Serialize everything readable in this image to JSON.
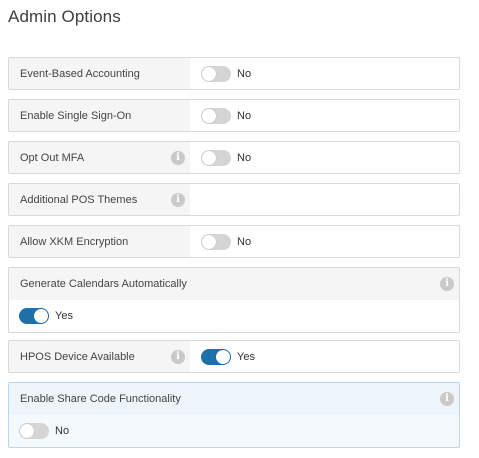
{
  "title": "Admin Options",
  "options": [
    {
      "label": "Event-Based Accounting",
      "value": "No"
    },
    {
      "label": "Enable Single Sign-On",
      "value": "No"
    },
    {
      "label": "Opt Out MFA",
      "value": "No"
    },
    {
      "label": "Additional POS Themes"
    },
    {
      "label": "Allow XKM Encryption",
      "value": "No"
    },
    {
      "label": "Generate Calendars Automatically",
      "value": "Yes"
    },
    {
      "label": "HPOS Device Available",
      "value": "Yes"
    },
    {
      "label": "Enable Share Code Functionality",
      "value": "No"
    }
  ],
  "info_glyph": "i",
  "icons": [
    "info-icon"
  ],
  "colors": {
    "toggle_on": "#1f6fa8",
    "toggle_off": "#d5d5d5",
    "highlight_border": "#b9d7e8"
  }
}
